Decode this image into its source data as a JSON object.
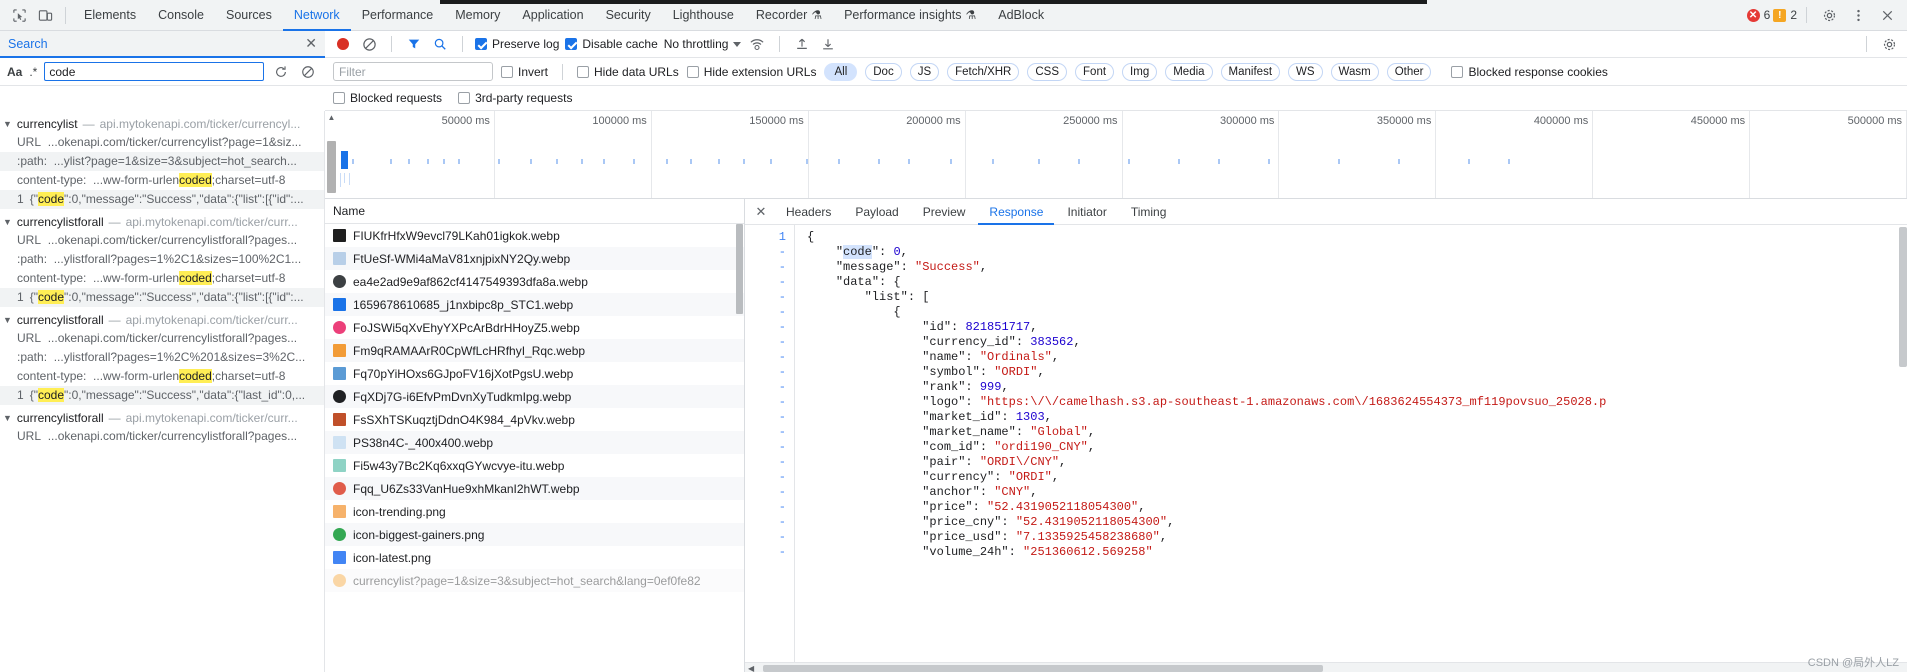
{
  "window": {
    "tabs": [
      {
        "label": "Elements",
        "active": false,
        "flask": false
      },
      {
        "label": "Console",
        "active": false,
        "flask": false
      },
      {
        "label": "Sources",
        "active": false,
        "flask": false
      },
      {
        "label": "Network",
        "active": true,
        "flask": false
      },
      {
        "label": "Performance",
        "active": false,
        "flask": false
      },
      {
        "label": "Memory",
        "active": false,
        "flask": false
      },
      {
        "label": "Application",
        "active": false,
        "flask": false
      },
      {
        "label": "Security",
        "active": false,
        "flask": false
      },
      {
        "label": "Lighthouse",
        "active": false,
        "flask": false
      },
      {
        "label": "Recorder",
        "active": false,
        "flask": true
      },
      {
        "label": "Performance insights",
        "active": false,
        "flask": true
      },
      {
        "label": "AdBlock",
        "active": false,
        "flask": false
      }
    ],
    "error_count": "6",
    "warning_count": "2",
    "inspect_icon": "inspect-element-icon",
    "device_icon": "device-toolbar-icon",
    "settings_icon": "gear-icon",
    "more_icon": "more-options-icon",
    "close_icon": "close-icon"
  },
  "search": {
    "title": "Search",
    "close_label": "✕",
    "match_case_label": "Aa",
    "regex_label": ".*",
    "query": "code",
    "refresh_icon": "refresh-icon",
    "clear_icon": "clear-icon",
    "results": [
      {
        "name": "currencylist",
        "dash": "—",
        "url": "api.mytokenapi.com/ticker/currencyl...",
        "lines": [
          {
            "key": "URL",
            "text": "...okenapi.com/ticker/currencylist?page=1&siz...",
            "alt": false,
            "hl": null
          },
          {
            "key": ":path:",
            "text": "...ylist?page=1&size=3&subject=hot_search...",
            "alt": true,
            "hl": null
          },
          {
            "key": "content-type:",
            "text": "...ww-form-urlen",
            "alt": false,
            "hl": "coded",
            "after": ";charset=utf-8"
          },
          {
            "key": "1",
            "text": "{\"",
            "alt": true,
            "hl": "code",
            "after": "\":0,\"message\":\"Success\",\"data\":{\"list\":[{\"id\":..."
          }
        ]
      },
      {
        "name": "currencylistforall",
        "dash": "—",
        "url": "api.mytokenapi.com/ticker/curr...",
        "lines": [
          {
            "key": "URL",
            "text": "...okenapi.com/ticker/currencylistforall?pages...",
            "alt": false,
            "hl": null
          },
          {
            "key": ":path:",
            "text": "...ylistforall?pages=1%2C1&sizes=100%2C1...",
            "alt": false,
            "hl": null
          },
          {
            "key": "content-type:",
            "text": "...ww-form-urlen",
            "alt": false,
            "hl": "coded",
            "after": ";charset=utf-8"
          },
          {
            "key": "1",
            "text": "{\"",
            "alt": true,
            "hl": "code",
            "after": "\":0,\"message\":\"Success\",\"data\":{\"list\":[{\"id\":..."
          }
        ]
      },
      {
        "name": "currencylistforall",
        "dash": "—",
        "url": "api.mytokenapi.com/ticker/curr...",
        "lines": [
          {
            "key": "URL",
            "text": "...okenapi.com/ticker/currencylistforall?pages...",
            "alt": false,
            "hl": null
          },
          {
            "key": ":path:",
            "text": "...ylistforall?pages=1%2C%201&sizes=3%2C...",
            "alt": false,
            "hl": null
          },
          {
            "key": "content-type:",
            "text": "...ww-form-urlen",
            "alt": false,
            "hl": "coded",
            "after": ";charset=utf-8"
          },
          {
            "key": "1",
            "text": "{\"",
            "alt": true,
            "hl": "code",
            "after": "\":0,\"message\":\"Success\",\"data\":{\"last_id\":0,..."
          }
        ]
      },
      {
        "name": "currencylistforall",
        "dash": "—",
        "url": "api.mytokenapi.com/ticker/curr...",
        "lines": [
          {
            "key": "URL",
            "text": "...okenapi.com/ticker/currencylistforall?pages...",
            "alt": false,
            "hl": null
          }
        ]
      }
    ]
  },
  "network_toolbar": {
    "record_icon": "record-stop-icon",
    "clear_icon": "clear-network-icon",
    "filter_icon": "filter-funnel-icon",
    "searchbtn_icon": "search-icon",
    "preserve_log": {
      "label": "Preserve log",
      "checked": true
    },
    "disable_cache": {
      "label": "Disable cache",
      "checked": true
    },
    "throttling": "No throttling",
    "wifi_icon": "network-conditions-icon",
    "import_icon": "import-har-icon",
    "export_icon": "export-har-icon",
    "settings_icon": "network-settings-gear-icon"
  },
  "filter_bar": {
    "filter_placeholder": "Filter",
    "filter_value": "",
    "invert": {
      "label": "Invert",
      "checked": false
    },
    "hide_data_urls": {
      "label": "Hide data URLs",
      "checked": false
    },
    "hide_extension_urls": {
      "label": "Hide extension URLs",
      "checked": false
    },
    "types": [
      "All",
      "Doc",
      "JS",
      "Fetch/XHR",
      "CSS",
      "Font",
      "Img",
      "Media",
      "Manifest",
      "WS",
      "Wasm",
      "Other"
    ],
    "active_type": "All",
    "blocked_response_cookies": {
      "label": "Blocked response cookies",
      "checked": false
    },
    "blocked_requests": {
      "label": "Blocked requests",
      "checked": false
    },
    "third_party_requests": {
      "label": "3rd-party requests",
      "checked": false
    }
  },
  "timeline": {
    "ticks": [
      "50000 ms",
      "100000 ms",
      "150000 ms",
      "200000 ms",
      "250000 ms",
      "300000 ms",
      "350000 ms",
      "400000 ms",
      "450000 ms",
      "500000 ms"
    ]
  },
  "requests": {
    "column_header": "Name",
    "rows": [
      {
        "name": "FIUKfrHfxW9evcl79LKah01igkok.webp",
        "icon": "image-file-icon",
        "color": "#1f1f1f"
      },
      {
        "name": "FtUeSf-WMi4aMaV81xnjpixNY2Qy.webp",
        "icon": "image-file-icon",
        "color": "#b8cfe8"
      },
      {
        "name": "ea4e2ad9e9af862cf4147549393dfa8a.webp",
        "icon": "image-file-icon",
        "color": "#3c4043"
      },
      {
        "name": "1659678610685_j1nxbipc8p_STC1.webp",
        "icon": "image-file-icon",
        "color": "#1a73e8"
      },
      {
        "name": "FoJSWi5qXvEhyYXPcArBdrHHoyZ5.webp",
        "icon": "image-file-icon",
        "color": "#ec407a"
      },
      {
        "name": "Fm9qRAMAArR0CpWfLcHRfhyI_Rqc.webp",
        "icon": "image-file-icon",
        "color": "#f29c38"
      },
      {
        "name": "Fq70pYiHOxs6GJpoFV16jXotPgsU.webp",
        "icon": "image-file-icon",
        "color": "#5b9bd5"
      },
      {
        "name": "FqXDj7G-i6EfvPmDvnXyTudkmIpg.webp",
        "icon": "image-file-icon",
        "color": "#202124"
      },
      {
        "name": "FsSXhTSKuqztjDdnO4K984_4pVkv.webp",
        "icon": "image-file-icon",
        "color": "#c0502a"
      },
      {
        "name": "PS38n4C-_400x400.webp",
        "icon": "image-file-icon",
        "color": "#cfe2f3"
      },
      {
        "name": "Fi5w43y7Bc2Kq6xxqGYwcvye-itu.webp",
        "icon": "image-file-icon",
        "color": "#8fd3c5"
      },
      {
        "name": "Fqq_U6Zs33VanHue9xhMkanI2hWT.webp",
        "icon": "image-file-icon",
        "color": "#e05c4a"
      },
      {
        "name": "icon-trending.png",
        "icon": "image-file-icon",
        "color": "#f6b26b"
      },
      {
        "name": "icon-biggest-gainers.png",
        "icon": "image-file-icon",
        "color": "#34a853"
      },
      {
        "name": "icon-latest.png",
        "icon": "image-file-icon",
        "color": "#4285f4"
      },
      {
        "name": "currencylist?page=1&size=3&subject=hot_search&lang=0ef0fe82",
        "icon": "xhr-file-icon",
        "color": "#f4a63a"
      }
    ]
  },
  "detail": {
    "close_label": "✕",
    "tabs": [
      "Headers",
      "Payload",
      "Preview",
      "Response",
      "Initiator",
      "Timing"
    ],
    "active_tab": "Response",
    "gutter": [
      "1",
      "-",
      "-",
      "-",
      "-",
      "-",
      "-",
      "-",
      "-",
      "-",
      "-",
      "-",
      "-",
      "-",
      "-",
      "-",
      "-",
      "-",
      "-",
      "-",
      "-",
      "-",
      "-",
      "-",
      "-",
      "-",
      "-"
    ],
    "lines": [
      {
        "indent": 0,
        "parts": [
          {
            "t": "{",
            "c": "plain"
          }
        ]
      },
      {
        "indent": 1,
        "parts": [
          {
            "t": "\"",
            "c": "plain"
          },
          {
            "t": "code",
            "c": "hl"
          },
          {
            "t": "\": ",
            "c": "plain"
          },
          {
            "t": "0",
            "c": "num"
          },
          {
            "t": ",",
            "c": "plain"
          }
        ]
      },
      {
        "indent": 1,
        "parts": [
          {
            "t": "\"message\": ",
            "c": "plain"
          },
          {
            "t": "\"Success\"",
            "c": "str"
          },
          {
            "t": ",",
            "c": "plain"
          }
        ]
      },
      {
        "indent": 1,
        "parts": [
          {
            "t": "\"data\": {",
            "c": "plain"
          }
        ]
      },
      {
        "indent": 2,
        "parts": [
          {
            "t": "\"list\": [",
            "c": "plain"
          }
        ]
      },
      {
        "indent": 3,
        "parts": [
          {
            "t": "{",
            "c": "plain"
          }
        ]
      },
      {
        "indent": 4,
        "parts": [
          {
            "t": "\"id\": ",
            "c": "plain"
          },
          {
            "t": "821851717",
            "c": "num"
          },
          {
            "t": ",",
            "c": "plain"
          }
        ]
      },
      {
        "indent": 4,
        "parts": [
          {
            "t": "\"currency_id\": ",
            "c": "plain"
          },
          {
            "t": "383562",
            "c": "num"
          },
          {
            "t": ",",
            "c": "plain"
          }
        ]
      },
      {
        "indent": 4,
        "parts": [
          {
            "t": "\"name\": ",
            "c": "plain"
          },
          {
            "t": "\"Ordinals\"",
            "c": "str"
          },
          {
            "t": ",",
            "c": "plain"
          }
        ]
      },
      {
        "indent": 4,
        "parts": [
          {
            "t": "\"symbol\": ",
            "c": "plain"
          },
          {
            "t": "\"ORDI\"",
            "c": "str"
          },
          {
            "t": ",",
            "c": "plain"
          }
        ]
      },
      {
        "indent": 4,
        "parts": [
          {
            "t": "\"rank\": ",
            "c": "plain"
          },
          {
            "t": "999",
            "c": "num"
          },
          {
            "t": ",",
            "c": "plain"
          }
        ]
      },
      {
        "indent": 4,
        "parts": [
          {
            "t": "\"logo\": ",
            "c": "plain"
          },
          {
            "t": "\"https:\\/\\/camelhash.s3.ap-southeast-1.amazonaws.com\\/1683624554373_mf119povsuo_25028.p",
            "c": "str"
          }
        ]
      },
      {
        "indent": 4,
        "parts": [
          {
            "t": "\"market_id\": ",
            "c": "plain"
          },
          {
            "t": "1303",
            "c": "num"
          },
          {
            "t": ",",
            "c": "plain"
          }
        ]
      },
      {
        "indent": 4,
        "parts": [
          {
            "t": "\"market_name\": ",
            "c": "plain"
          },
          {
            "t": "\"Global\"",
            "c": "str"
          },
          {
            "t": ",",
            "c": "plain"
          }
        ]
      },
      {
        "indent": 4,
        "parts": [
          {
            "t": "\"com_id\": ",
            "c": "plain"
          },
          {
            "t": "\"ordi190_CNY\"",
            "c": "str"
          },
          {
            "t": ",",
            "c": "plain"
          }
        ]
      },
      {
        "indent": 4,
        "parts": [
          {
            "t": "\"pair\": ",
            "c": "plain"
          },
          {
            "t": "\"ORDI\\/CNY\"",
            "c": "str"
          },
          {
            "t": ",",
            "c": "plain"
          }
        ]
      },
      {
        "indent": 4,
        "parts": [
          {
            "t": "\"currency\": ",
            "c": "plain"
          },
          {
            "t": "\"ORDI\"",
            "c": "str"
          },
          {
            "t": ",",
            "c": "plain"
          }
        ]
      },
      {
        "indent": 4,
        "parts": [
          {
            "t": "\"anchor\": ",
            "c": "plain"
          },
          {
            "t": "\"CNY\"",
            "c": "str"
          },
          {
            "t": ",",
            "c": "plain"
          }
        ]
      },
      {
        "indent": 4,
        "parts": [
          {
            "t": "\"price\": ",
            "c": "plain"
          },
          {
            "t": "\"52.4319052118054300\"",
            "c": "str"
          },
          {
            "t": ",",
            "c": "plain"
          }
        ]
      },
      {
        "indent": 4,
        "parts": [
          {
            "t": "\"price_cny\": ",
            "c": "plain"
          },
          {
            "t": "\"52.4319052118054300\"",
            "c": "str"
          },
          {
            "t": ",",
            "c": "plain"
          }
        ]
      },
      {
        "indent": 4,
        "parts": [
          {
            "t": "\"price_usd\": ",
            "c": "plain"
          },
          {
            "t": "\"7.1335925458238680\"",
            "c": "str"
          },
          {
            "t": ",",
            "c": "plain"
          }
        ]
      },
      {
        "indent": 4,
        "parts": [
          {
            "t": "\"volume_24h\": ",
            "c": "plain"
          },
          {
            "t": "\"251360612.569258\"",
            "c": "str"
          }
        ]
      }
    ]
  },
  "watermark": "CSDN @局外人LZ"
}
